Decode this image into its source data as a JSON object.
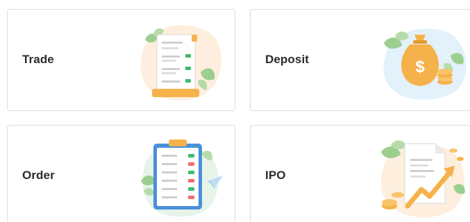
{
  "cards": [
    {
      "id": "trade",
      "label": "Trade",
      "icon": "trade-receipt-icon"
    },
    {
      "id": "deposit",
      "label": "Deposit",
      "icon": "money-bag-icon"
    },
    {
      "id": "order",
      "label": "Order",
      "icon": "order-clipboard-icon"
    },
    {
      "id": "ipo",
      "label": "IPO",
      "icon": "ipo-growth-document-icon"
    }
  ],
  "colors": {
    "card_border": "#dcdcdc",
    "label_text": "#2b2b2b",
    "accent_orange": "#f6b24a",
    "accent_green": "#3dbb6e",
    "accent_red": "#f16a6a",
    "accent_blue": "#4a90d9",
    "leaf_green": "#9ccf8f"
  }
}
